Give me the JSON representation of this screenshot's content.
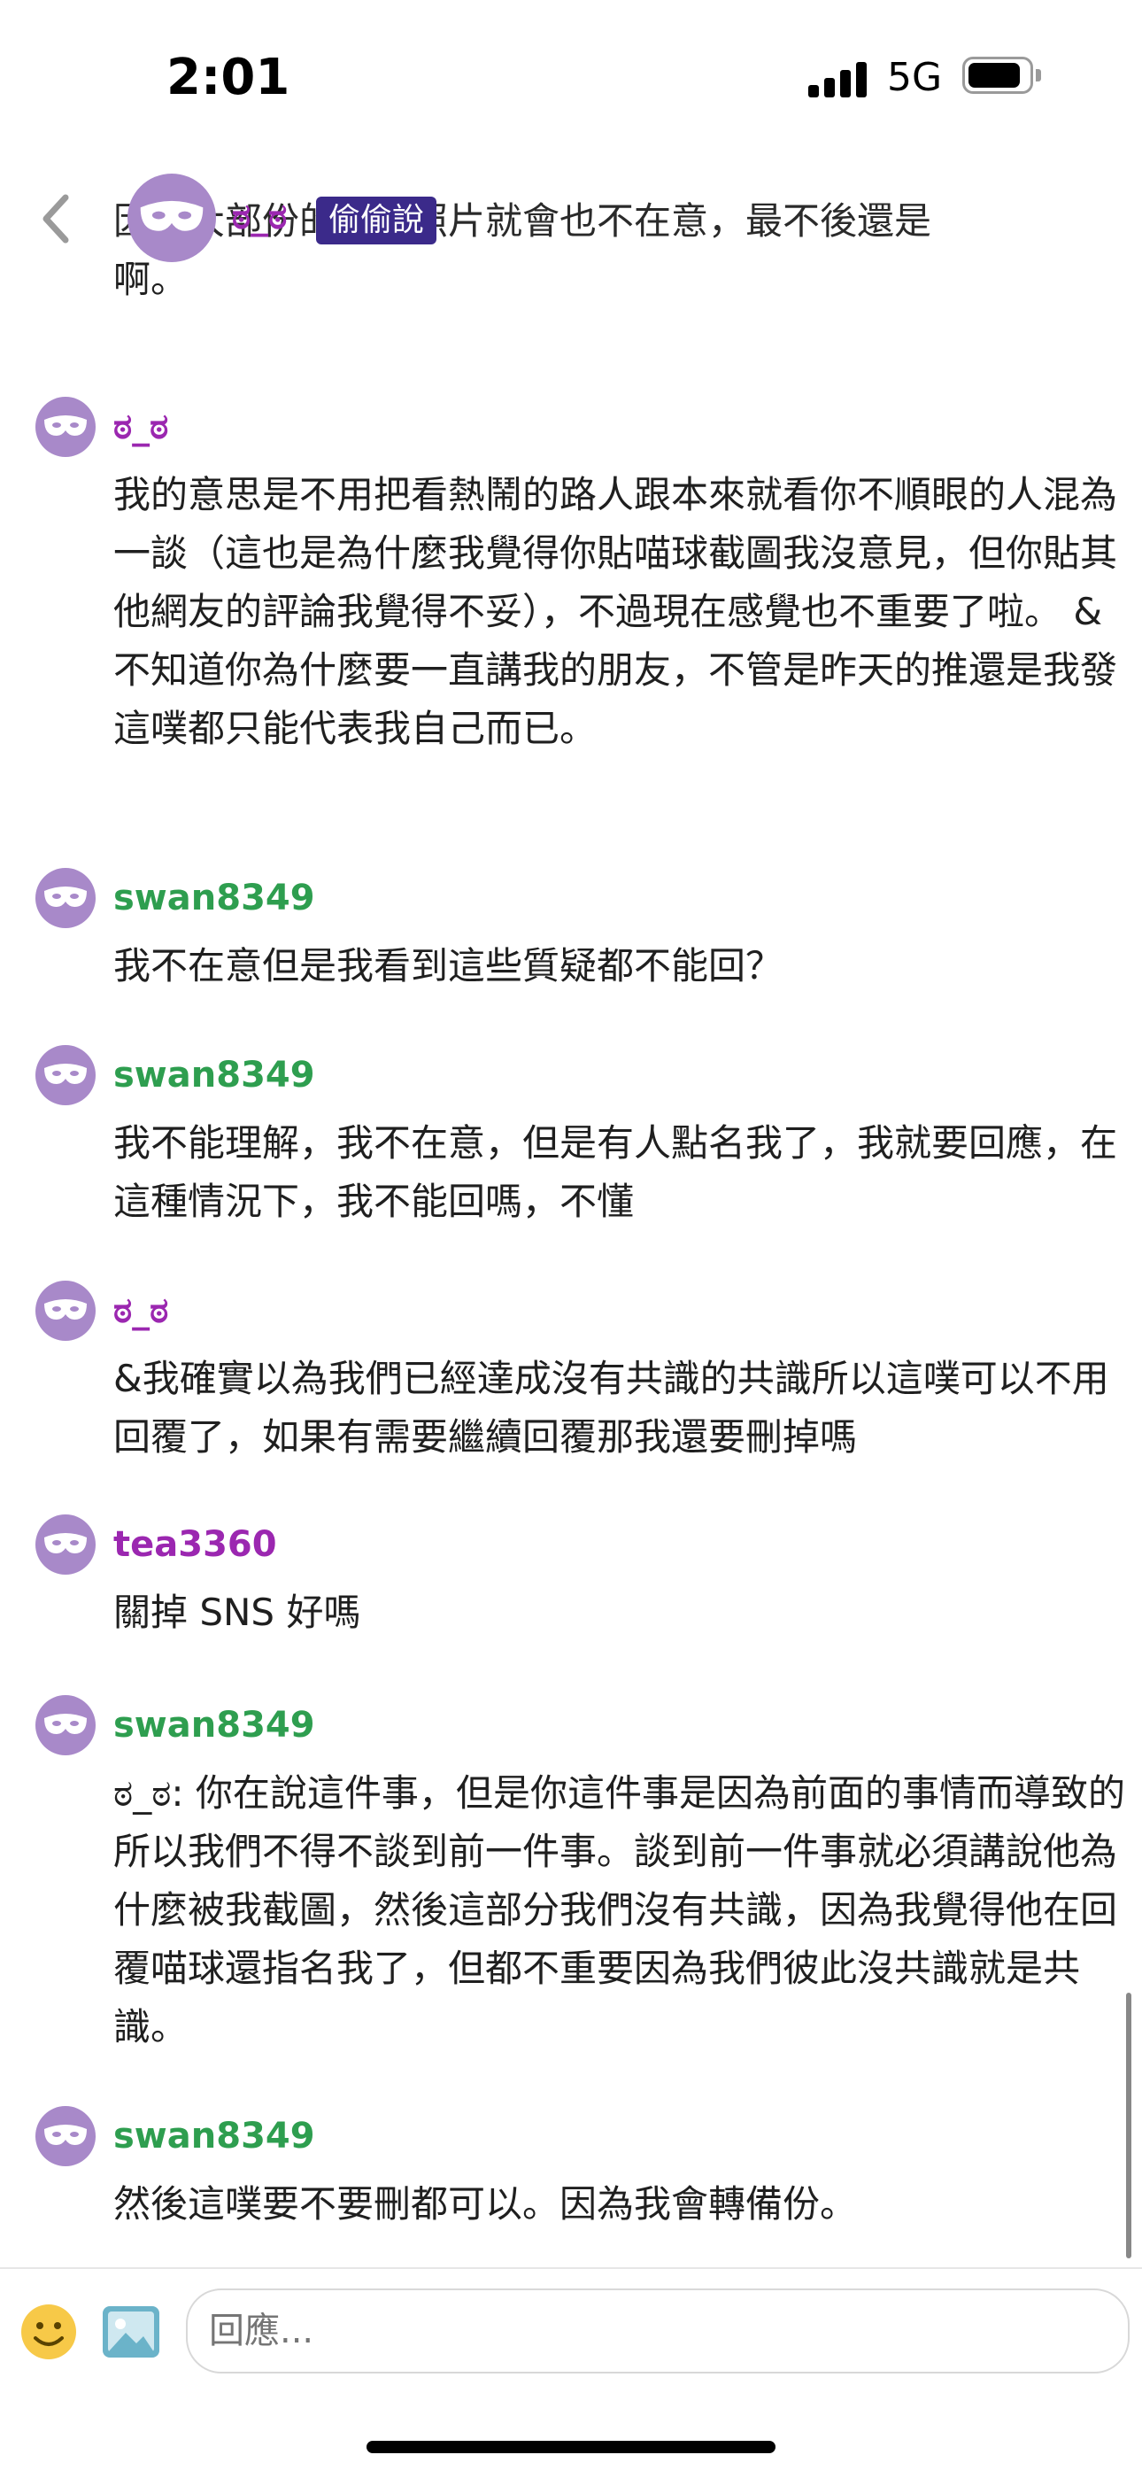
{
  "status_bar": {
    "time": "2:01",
    "network": "5G"
  },
  "header": {
    "username": "ಠ_ಠ",
    "badge": "偷偷說"
  },
  "clipped_text": {
    "hidden_line": "因為大部份的實況照片就會也不在意，最不後還是",
    "visible_line": "啊。"
  },
  "messages": [
    {
      "user": "ಠ_ಠ",
      "text": "我的意思是不用把看熱鬧的路人跟本來就看你不順眼的人混為一談（這也是為什麼我覺得你貼喵球截圖我沒意見，但你貼其他網友的評論我覺得不妥），不過現在感覺也不重要了啦。 &不知道你為什麼要一直講我的朋友，不管是昨天的推還是我發這噗都只能代表我自己而已。"
    },
    {
      "user": "swan8349",
      "text": "我不在意但是我看到這些質疑都不能回？"
    },
    {
      "user": "swan8349",
      "text": "我不能理解，我不在意，但是有人點名我了，我就要回應，在這種情況下，我不能回嗎，不懂"
    },
    {
      "user": "ಠ_ಠ",
      "text": "&我確實以為我們已經達成沒有共識的共識所以這噗可以不用回覆了，如果有需要繼續回覆那我還要刪掉嗎"
    },
    {
      "user": "tea3360",
      "text": "關掉 SNS 好嗎"
    },
    {
      "user": "swan8349",
      "text": "ಠ_ಠ: 你在說這件事，但是你這件事是因為前面的事情而導致的所以我們不得不談到前一件事。談到前一件事就必須講說他為什麼被我截圖，然後這部分我們沒有共識，因為我覺得他在回覆喵球還指名我了，但都不重要因為我們彼此沒共識就是共識。"
    },
    {
      "user": "swan8349",
      "text": "然後這噗要不要刪都可以。因為我會轉備份。"
    }
  ],
  "composer": {
    "placeholder": "回應..."
  },
  "colors": {
    "purple_user": "#9b27b0",
    "green_user": "#2e9e4f",
    "badge_bg": "#3b2a8a",
    "avatar": "#a889c9"
  },
  "icons": {
    "back": "chevron-left-icon",
    "avatar": "mask-avatar-icon",
    "emoji": "emoji-icon",
    "image": "image-icon"
  }
}
